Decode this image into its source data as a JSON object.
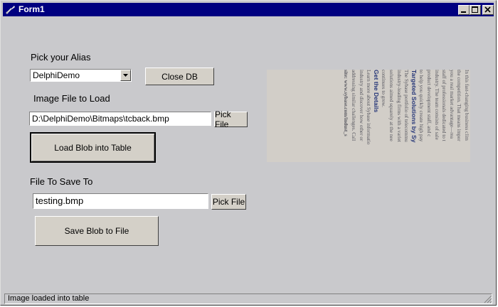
{
  "window": {
    "title": "Form1"
  },
  "labels": {
    "pick_alias": "Pick your Alias",
    "image_file": "Image File to Load",
    "file_to_save": "File To Save To"
  },
  "alias_combo": {
    "selected": "DelphiDemo"
  },
  "buttons": {
    "close_db": "Close DB",
    "pick_file_load": "Pick File",
    "load_blob": "Load Blob into Table",
    "pick_file_save": "Pick File",
    "save_blob": "Save Blob to File"
  },
  "inputs": {
    "image_path": "D:\\DelphiDemo\\Bitmaps\\tcback.bmp",
    "save_path": "testing.bmp"
  },
  "image_text": {
    "lines": [
      "In this fast-changing business clim",
      "the competition. That means impor",
      "you a real market advantage—rea",
      "staff of professionals dedicated to t",
      "industry. The team consists of sale",
      "product development staff, and c",
      "to help you quickly create high pay",
      "Targeted Solutions by Sy",
      "The Sybase portfolio of telecommu",
      "industry-leading firms with a variet",
      "solutions aimed squarely at the nee",
      "continues to grow.",
      "Get the Details",
      "Learn more about Sybase informatio",
      "industry and discover how other or",
      "addressing similar challenges. Call",
      "site: www.sybase.com/indust_s"
    ]
  },
  "statusbar": {
    "text": "Image loaded into table"
  }
}
